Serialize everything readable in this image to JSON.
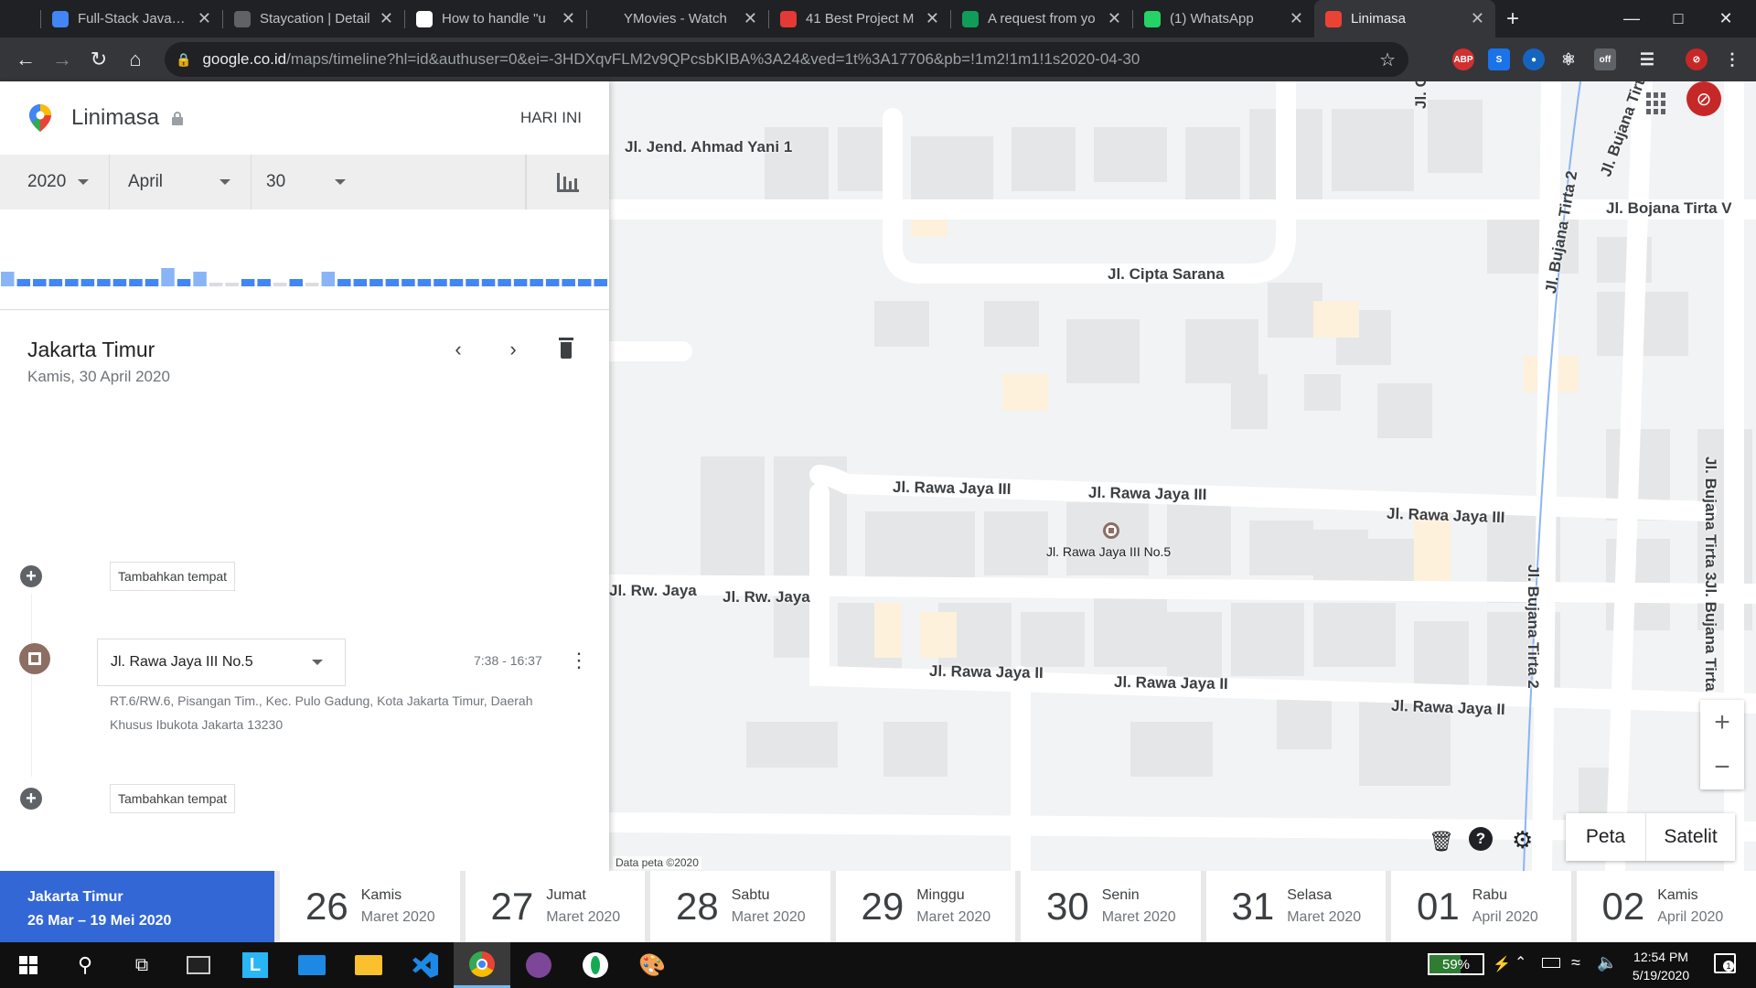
{
  "tabs": [
    {
      "title": "",
      "icon": "spy-icon",
      "color": "#202124"
    },
    {
      "title": "Full-Stack JavaScri",
      "icon": "atom-icon",
      "color": "#4285f4"
    },
    {
      "title": "Staycation | Detail",
      "icon": "globe-icon",
      "color": "#5f6368"
    },
    {
      "title": "How to handle \"u",
      "icon": "github-icon",
      "color": "#ffffff"
    },
    {
      "title": "YMovies - Watch",
      "icon": "y-icon",
      "color": "#202124"
    },
    {
      "title": "41 Best Project M",
      "icon": "s-icon",
      "color": "#e53935"
    },
    {
      "title": "A request from yo",
      "icon": "clover-icon",
      "color": "#0f9d58"
    },
    {
      "title": "(1) WhatsApp",
      "icon": "whatsapp-icon",
      "color": "#25d366"
    },
    {
      "title": "Linimasa",
      "icon": "maps-pin-icon",
      "color": "#ea4335"
    }
  ],
  "omnibox": {
    "domain": "google.co.id",
    "path": "/maps/timeline?hl=id&authuser=0&ei=-3HDXqvFLM2v9QPcsbKIBA%3A24&ved=1t%3A17706&pb=!1m2!1m1!1s2020-04-30"
  },
  "panel": {
    "title": "Linimasa",
    "today": "HARI INI",
    "year": "2020",
    "month": "April",
    "day": "30",
    "place": "Jakarta Timur",
    "date": "Kamis, 30 April 2020",
    "add_place": "Tambahkan tempat",
    "visit": {
      "name": "Jl. Rawa Jaya III No.5",
      "time": "7:38 - 16:37",
      "address": "RT.6/RW.6, Pisangan Tim., Kec. Pulo Gadung, Kota Jakarta Timur, Daerah Khusus Ibukota Jakarta 13230"
    },
    "histogram": [
      0.4,
      0.2,
      0.2,
      0.2,
      0.2,
      0.2,
      0.2,
      0.2,
      0.2,
      0.2,
      0.5,
      0.2,
      0.4,
      0.1,
      0.1,
      0.2,
      0.2,
      0.1,
      0.2,
      0.1,
      0.4,
      0.2,
      0.2,
      0.2,
      0.2,
      0.2,
      0.2,
      0.2,
      0.2,
      0.2,
      0.2,
      0.2,
      0.2,
      0.2,
      0.2,
      0.2,
      0.2,
      0.2
    ]
  },
  "map": {
    "roads": [
      "Jl. Jend. Ahmad Yani 1",
      "Jl. Cipta Sarana",
      "Jl. Bojana Tirta V",
      "Jl. Bujana Tirta 2",
      "Jl. Bujana Tirta 3",
      "Jl. Rawa Jaya III",
      "Jl. Rawa Jaya III",
      "Jl. Rawa Jaya III",
      "Jl. Rw. Jaya",
      "Jl. Rw. Jaya",
      "Jl. Rawa Jaya II",
      "Jl. Rawa Jaya II",
      "Jl. Rawa Jaya II",
      "Jl. Bujana Tirta 2",
      "Jl. Bujana Tirta",
      "Jl. Bujana Tirta",
      "Jl. C"
    ],
    "marker_label": "Jl. Rawa Jaya III No.5",
    "credit": "Data peta ©2020",
    "map_btn": "Peta",
    "sat_btn": "Satelit"
  },
  "strip": {
    "current_place": "Jakarta Timur",
    "range": "26 Mar – 19 Mei 2020",
    "days": [
      {
        "num": "26",
        "dw": "Kamis",
        "mo": "Maret 2020"
      },
      {
        "num": "27",
        "dw": "Jumat",
        "mo": "Maret 2020"
      },
      {
        "num": "28",
        "dw": "Sabtu",
        "mo": "Maret 2020"
      },
      {
        "num": "29",
        "dw": "Minggu",
        "mo": "Maret 2020"
      },
      {
        "num": "30",
        "dw": "Senin",
        "mo": "Maret 2020"
      },
      {
        "num": "31",
        "dw": "Selasa",
        "mo": "Maret 2020"
      },
      {
        "num": "01",
        "dw": "Rabu",
        "mo": "April 2020"
      },
      {
        "num": "02",
        "dw": "Kamis",
        "mo": "April 2020"
      }
    ]
  },
  "taskbar": {
    "battery": "59%",
    "time": "12:54 PM",
    "date": "5/19/2020",
    "notif": "1"
  }
}
